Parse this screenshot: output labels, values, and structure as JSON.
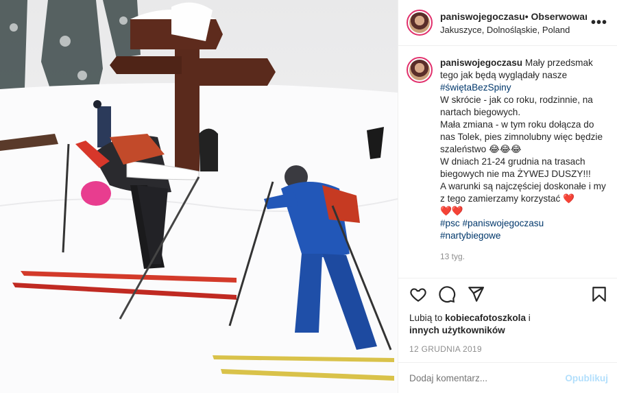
{
  "header": {
    "username": "paniswojegoczasu",
    "separator": "•",
    "follow_label": "Obserwowanie",
    "location": "Jakuszyce, Dolnośląskie, Poland",
    "more_icon": "more-horizontal-icon"
  },
  "caption": {
    "username": "paniswojegoczasu",
    "lines": [
      "Mały przedsmak tego jak będą wyglądały nasze",
      "#świętaBezSpiny",
      "W skrócie - jak co roku, rodzinnie, na nartach biegowych.",
      "Mała zmiana - w tym roku dołącza do nas Tolek, pies zimnolubny więc będzie szaleństwo 😂😂😂",
      "W dniach 21-24 grudnia na trasach biegowych nie ma ŻYWEJ DUSZY!!!",
      "A warunki są najczęściej doskonałe i my z tego zamierzamy korzystać ❤️",
      "❤️❤️",
      "#psc #paniswojegoczasu",
      "#nartybiegowe"
    ],
    "time_ago": "13 tyg."
  },
  "actions": {
    "icons": [
      "heart-icon",
      "comment-icon",
      "share-icon",
      "bookmark-icon"
    ],
    "likes_prefix": "Lubią to",
    "likes_user": "kobiecafotoszkola",
    "likes_and": "i",
    "likes_others": "innych użytkowników",
    "date": "12 GRUDNIA 2019"
  },
  "comment": {
    "placeholder": "Dodaj komentarz...",
    "post_label": "Opublikuj"
  },
  "colors": {
    "link": "#00376b",
    "muted": "#8e8e8e",
    "post_disabled": "#b2dffc",
    "story_ring": "#e1306c"
  }
}
